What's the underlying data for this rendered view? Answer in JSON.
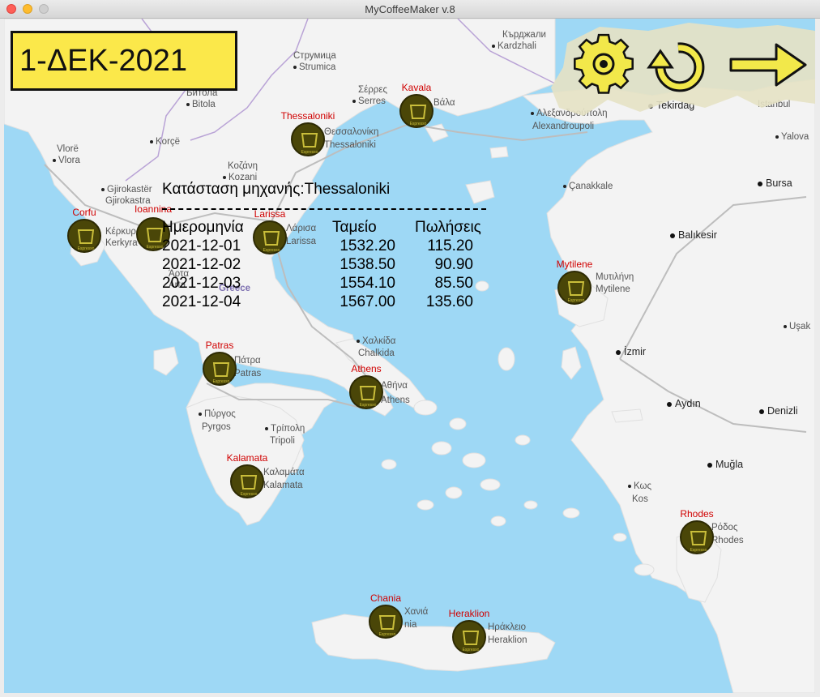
{
  "window": {
    "title": "MyCoffeeMaker v.8"
  },
  "date_badge": "1-ΔΕΚ-2021",
  "toolbar": {
    "settings_icon": "gear-icon",
    "refresh_icon": "rotate-left-icon",
    "next_icon": "arrow-right-icon"
  },
  "colors": {
    "sea": "#9ed8f5",
    "land": "#f3f3f3",
    "marker": "#4a4608",
    "marker_label": "#d00000",
    "badge": "#fbe84a",
    "toolbar": "#f2e84a"
  },
  "status": {
    "title": "Κατάσταση μηχανής:Thessaloniki",
    "columns": [
      "Ημερομηνία",
      "Ταμείο",
      "Πωλήσεις"
    ],
    "rows": [
      [
        "2021-12-01",
        "1532.20",
        "115.20"
      ],
      [
        "2021-12-02",
        "1538.50",
        "90.90"
      ],
      [
        "2021-12-03",
        "1554.10",
        "85.50"
      ],
      [
        "2021-12-04",
        "1567.00",
        "135.60"
      ]
    ]
  },
  "machines": [
    {
      "id": "kavala",
      "label": "Kavala"
    },
    {
      "id": "thessaloniki",
      "label": "Thessaloniki"
    },
    {
      "id": "corfu",
      "label": "Corfu"
    },
    {
      "id": "ioannina",
      "label": "Ioannina"
    },
    {
      "id": "larissa",
      "label": "Larissa"
    },
    {
      "id": "mytilene",
      "label": "Mytilene"
    },
    {
      "id": "patras",
      "label": "Patras"
    },
    {
      "id": "athens",
      "label": "Athens"
    },
    {
      "id": "kalamata",
      "label": "Kalamata"
    },
    {
      "id": "rhodes",
      "label": "Rhodes"
    },
    {
      "id": "chania",
      "label": "Chania"
    },
    {
      "id": "heraklion",
      "label": "Heraklion"
    }
  ],
  "marker_text": "Espresso",
  "map_places": [
    "Струмица",
    "Strumica",
    "Кърджали",
    "Kardzhali",
    "Σέρρες",
    "Serres",
    "Βάλα",
    "Αλεξανδρούπολη",
    "Alexandroupoli",
    "Tekirdag",
    "Istanbul",
    "Битола",
    "Bitola",
    "Korçë",
    "Vlorë",
    "Vlora",
    "Κοζάνη",
    "Kozani",
    "Gjirokastër",
    "Gjirokastra",
    "Κέρκυρα",
    "Kerkyra",
    "Θεσσαλονίκη",
    "Thessaloniki",
    "Çanakkale",
    "Bursa",
    "Yalova",
    "Balıkesir",
    "Μυτιλήνη",
    "Mytilene",
    "Λάρισα",
    "Larissa",
    "Άρτα",
    "Arta",
    "Greece",
    "Χαλκίδα",
    "Chalkida",
    "Αθήνα",
    "Athens",
    "Πάτρα",
    "Patras",
    "Πύργος",
    "Pyrgos",
    "Τρίπολη",
    "Tripoli",
    "Καλαμάτα",
    "Kalamata",
    "İzmir",
    "Uşak",
    "Aydın",
    "Denizli",
    "Muğla",
    "Κως",
    "Kos",
    "Ρόδος",
    "Rhodes",
    "Χανιά",
    "Chania",
    "Ηράκλειο",
    "Heraklion",
    "nia"
  ]
}
